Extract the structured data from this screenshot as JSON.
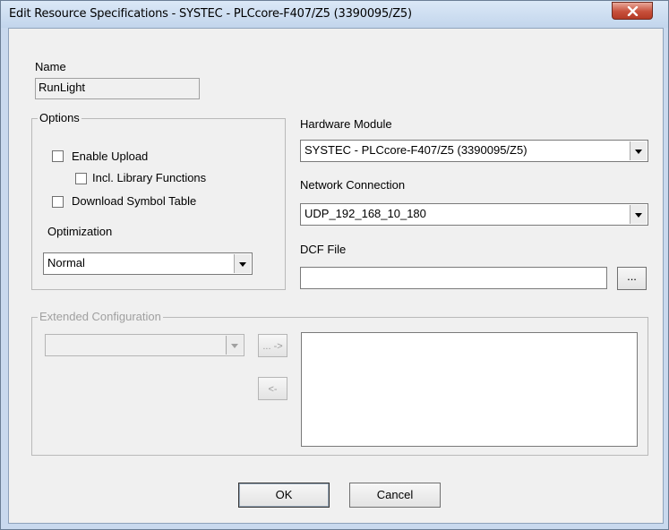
{
  "window": {
    "title": "Edit Resource Specifications - SYSTEC - PLCcore-F407/Z5 (3390095/Z5)"
  },
  "name": {
    "label": "Name",
    "value": "RunLight"
  },
  "options": {
    "title": "Options",
    "enable_upload": {
      "label": "Enable Upload",
      "checked": false
    },
    "incl_library": {
      "label": "Incl. Library Functions",
      "checked": false
    },
    "download_symbols": {
      "label": "Download Symbol Table",
      "checked": false
    },
    "optimization_label": "Optimization",
    "optimization_value": "Normal"
  },
  "hardware": {
    "label": "Hardware Module",
    "value": "SYSTEC - PLCcore-F407/Z5 (3390095/Z5)"
  },
  "network": {
    "label": "Network Connection",
    "value": "UDP_192_168_10_180"
  },
  "dcf": {
    "label": "DCF File",
    "value": "",
    "browse": "..."
  },
  "extended": {
    "title": "Extended Configuration",
    "add": "... ->",
    "remove": "<-"
  },
  "buttons": {
    "ok": "OK",
    "cancel": "Cancel"
  }
}
